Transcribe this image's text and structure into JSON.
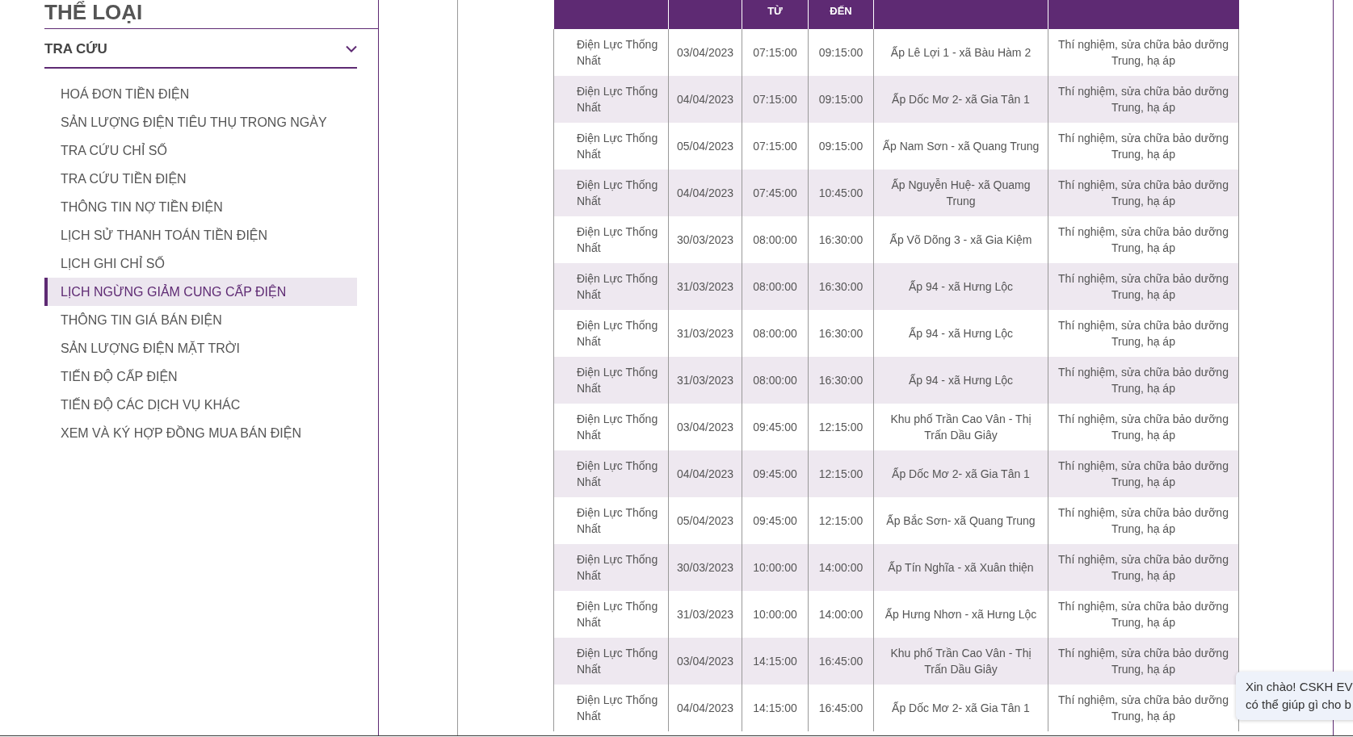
{
  "sidebar": {
    "heading": "THỂ LOẠI",
    "section": {
      "title": "TRA CỨU",
      "expanded": true
    },
    "items": [
      {
        "label": "HOÁ ĐƠN TIỀN ĐIỆN",
        "selected": false
      },
      {
        "label": "SẢN LƯỢNG ĐIỆN TIÊU THỤ TRONG NGÀY",
        "selected": false
      },
      {
        "label": "TRA CỨU CHỈ SỐ",
        "selected": false
      },
      {
        "label": "TRA CỨU TIỀN ĐIỆN",
        "selected": false
      },
      {
        "label": "THÔNG TIN NỢ TIỀN ĐIỆN",
        "selected": false
      },
      {
        "label": "LỊCH SỬ THANH TOÁN TIỀN ĐIỆN",
        "selected": false
      },
      {
        "label": "LỊCH GHI CHỈ SỐ",
        "selected": false
      },
      {
        "label": "LỊCH NGỪNG GIẢM CUNG CẤP ĐIỆN",
        "selected": true
      },
      {
        "label": "THÔNG TIN GIÁ BÁN ĐIỆN",
        "selected": false
      },
      {
        "label": "SẢN LƯỢNG ĐIỆN MẶT TRỜI",
        "selected": false
      },
      {
        "label": "TIẾN ĐỘ CẤP ĐIỆN",
        "selected": false
      },
      {
        "label": "TIẾN ĐỘ CÁC DỊCH VỤ KHÁC",
        "selected": false
      },
      {
        "label": "XEM VÀ KÝ HỢP ĐỒNG MUA BÁN ĐIỆN",
        "selected": false
      }
    ]
  },
  "table": {
    "columns": [
      {
        "kind": "blank"
      },
      {
        "kind": "blank"
      },
      {
        "kind": "text",
        "label": "TỪ"
      },
      {
        "kind": "text",
        "label": "ĐẾN"
      },
      {
        "kind": "blank"
      },
      {
        "kind": "blank"
      }
    ],
    "rows": [
      {
        "column_1": "Điện Lực Thống Nhất",
        "column_2": "03/04/2023",
        "column_3": "07:15:00",
        "column_4": "09:15:00",
        "column_5": "Ấp Lê Lợi 1 - xã Bàu Hàm 2",
        "column_6": "Thí nghiệm, sửa chữa bảo dưỡng Trung, hạ áp"
      },
      {
        "column_1": "Điện Lực Thống Nhất",
        "column_2": "04/04/2023",
        "column_3": "07:15:00",
        "column_4": "09:15:00",
        "column_5": "Ấp Dốc Mơ 2- xã Gia Tân 1",
        "column_6": "Thí nghiệm, sửa chữa bảo dưỡng Trung, hạ áp"
      },
      {
        "column_1": "Điện Lực Thống Nhất",
        "column_2": "05/04/2023",
        "column_3": "07:15:00",
        "column_4": "09:15:00",
        "column_5": "Ấp Nam Sơn - xã Quang Trung",
        "column_6": "Thí nghiệm, sửa chữa bảo dưỡng Trung, hạ áp"
      },
      {
        "column_1": "Điện Lực Thống Nhất",
        "column_2": "04/04/2023",
        "column_3": "07:45:00",
        "column_4": "10:45:00",
        "column_5": "Ấp Nguyễn Huệ- xã Quamg Trung",
        "column_6": "Thí nghiệm, sửa chữa bảo dưỡng Trung, hạ áp"
      },
      {
        "column_1": "Điện Lực Thống Nhất",
        "column_2": "30/03/2023",
        "column_3": "08:00:00",
        "column_4": "16:30:00",
        "column_5": "Ấp Võ Dõng 3 - xã Gia Kiệm",
        "column_6": "Thí nghiệm, sửa chữa bảo dưỡng Trung, hạ áp"
      },
      {
        "column_1": "Điện Lực Thống Nhất",
        "column_2": "31/03/2023",
        "column_3": "08:00:00",
        "column_4": "16:30:00",
        "column_5": "Ấp 94 - xã Hưng Lộc",
        "column_6": "Thí nghiệm, sửa chữa bảo dưỡng Trung, hạ áp"
      },
      {
        "column_1": "Điện Lực Thống Nhất",
        "column_2": "31/03/2023",
        "column_3": "08:00:00",
        "column_4": "16:30:00",
        "column_5": "Ấp 94 - xã Hưng Lộc",
        "column_6": "Thí nghiệm, sửa chữa bảo dưỡng Trung, hạ áp"
      },
      {
        "column_1": "Điện Lực Thống Nhất",
        "column_2": "31/03/2023",
        "column_3": "08:00:00",
        "column_4": "16:30:00",
        "column_5": "Ấp 94 - xã Hưng Lộc",
        "column_6": "Thí nghiệm, sửa chữa bảo dưỡng Trung, hạ áp"
      },
      {
        "column_1": "Điện Lực Thống Nhất",
        "column_2": "03/04/2023",
        "column_3": "09:45:00",
        "column_4": "12:15:00",
        "column_5": "Khu phố Trần Cao Vân - Thị Trấn Dầu Giây",
        "column_6": "Thí nghiệm, sửa chữa bảo dưỡng Trung, hạ áp"
      },
      {
        "column_1": "Điện Lực Thống Nhất",
        "column_2": "04/04/2023",
        "column_3": "09:45:00",
        "column_4": "12:15:00",
        "column_5": "Ấp Dốc Mơ 2- xã Gia Tân 1",
        "column_6": "Thí nghiệm, sửa chữa bảo dưỡng Trung, hạ áp"
      },
      {
        "column_1": "Điện Lực Thống Nhất",
        "column_2": "05/04/2023",
        "column_3": "09:45:00",
        "column_4": "12:15:00",
        "column_5": "Ấp Bắc Sơn- xã Quang Trung",
        "column_6": "Thí nghiệm, sửa chữa bảo dưỡng Trung, hạ áp"
      },
      {
        "column_1": "Điện Lực Thống Nhất",
        "column_2": "30/03/2023",
        "column_3": "10:00:00",
        "column_4": "14:00:00",
        "column_5": "Ấp Tín Nghĩa - xã Xuân thiện",
        "column_6": "Thí nghiệm, sửa chữa bảo dưỡng Trung, hạ áp"
      },
      {
        "column_1": "Điện Lực Thống Nhất",
        "column_2": "31/03/2023",
        "column_3": "10:00:00",
        "column_4": "14:00:00",
        "column_5": "Ấp Hưng Nhơn - xã Hưng Lộc",
        "column_6": "Thí nghiệm, sửa chữa bảo dưỡng Trung, hạ áp"
      },
      {
        "column_1": "Điện Lực Thống Nhất",
        "column_2": "03/04/2023",
        "column_3": "14:15:00",
        "column_4": "16:45:00",
        "column_5": "Khu phố Trần Cao Vân - Thị Trấn Dầu Giây",
        "column_6": "Thí nghiệm, sửa chữa bảo dưỡng Trung, hạ áp"
      },
      {
        "column_1": "Điện Lực Thống Nhất",
        "column_2": "04/04/2023",
        "column_3": "14:15:00",
        "column_4": "16:45:00",
        "column_5": "Ấp Dốc Mơ 2- xã Gia Tân 1",
        "column_6": "Thí nghiệm, sửa chữa bảo dưỡng Trung, hạ áp"
      }
    ]
  },
  "chat_bubble": {
    "lines": [
      "Xin chào! CSKH EV",
      "có thể giúp gì cho b"
    ]
  }
}
